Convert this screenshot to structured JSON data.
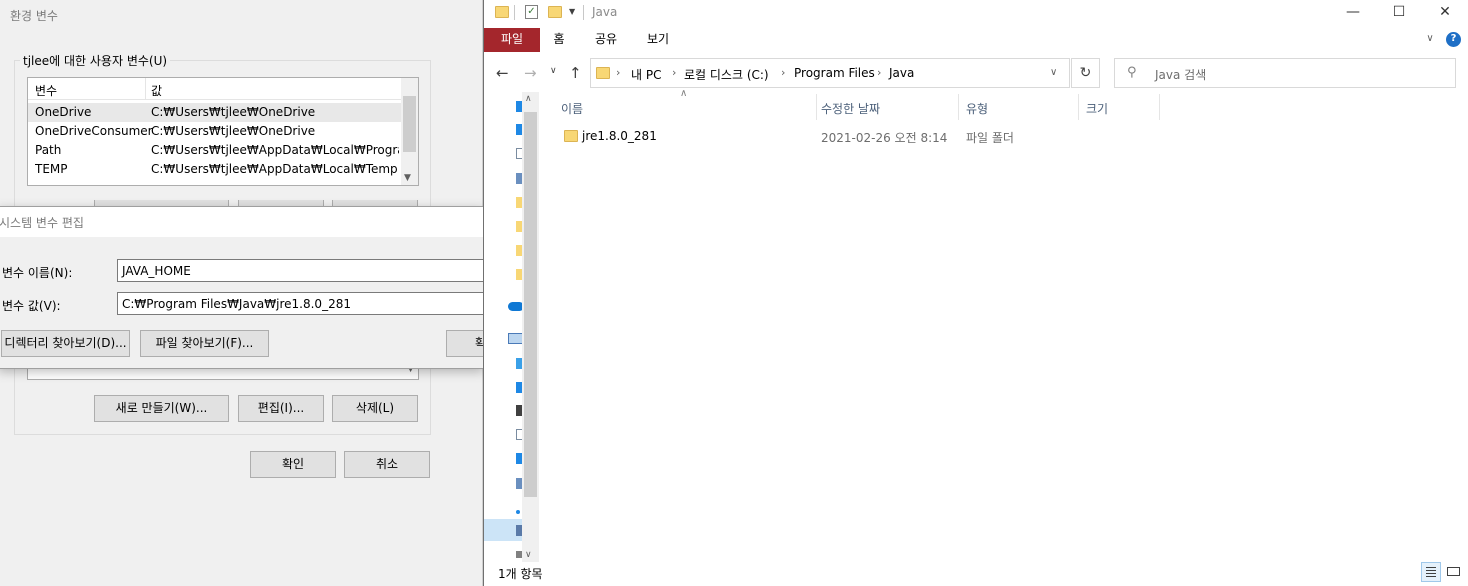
{
  "env_dialog": {
    "title": "환경 변수",
    "user_group_label": "tjlee에 대한 사용자 변수(U)",
    "list_headers": [
      "변수",
      "값"
    ],
    "user_vars": [
      {
        "name": "OneDrive",
        "value": "C:₩Users₩tjlee₩OneDrive"
      },
      {
        "name": "OneDriveConsumer",
        "value": "C:₩Users₩tjlee₩OneDrive"
      },
      {
        "name": "Path",
        "value": "C:₩Users₩tjlee₩AppData₩Local₩Programs..."
      },
      {
        "name": "TEMP",
        "value": "C:₩Users₩tjlee₩AppData₩Local₩Temp"
      }
    ],
    "new_button": "새로 만들기(W)...",
    "edit_button": "편집(I)...",
    "delete_button": "삭제(L)",
    "ok_button": "확인",
    "cancel_button": "취소"
  },
  "edit_dialog": {
    "title": "시스템 변수 편집",
    "name_label": "변수 이름(N):",
    "name_value": "JAVA_HOME",
    "value_label": "변수 값(V):",
    "value_value": "C:₩Program Files₩Java₩jre1.8.0_281",
    "browse_dir_button": "디렉터리 찾아보기(D)...",
    "browse_file_button": "파일 찾아보기(F)...",
    "ok_button_partial": "확"
  },
  "explorer": {
    "window_title": "Java",
    "ribbon_tabs": [
      "파일",
      "홈",
      "공유",
      "보기"
    ],
    "breadcrumb": [
      "내 PC",
      "로컬 디스크 (C:)",
      "Program Files",
      "Java"
    ],
    "search_placeholder": "Java 검색",
    "columns": [
      "이름",
      "수정한 날짜",
      "유형",
      "크기"
    ],
    "files": [
      {
        "name": "jre1.8.0_281",
        "modified": "2021-02-26 오전 8:14",
        "type": "파일 폴더",
        "size": ""
      }
    ],
    "status_text": "1개 항목",
    "icons": {
      "back": "arrow-left-icon",
      "forward": "arrow-right-icon",
      "up": "arrow-up-icon",
      "refresh": "refresh-icon",
      "search": "search-icon",
      "folder": "folder-icon"
    },
    "colors": {
      "file_tab": "#a4262c",
      "folder": "#f8d775",
      "header_text": "#4c607a"
    }
  }
}
